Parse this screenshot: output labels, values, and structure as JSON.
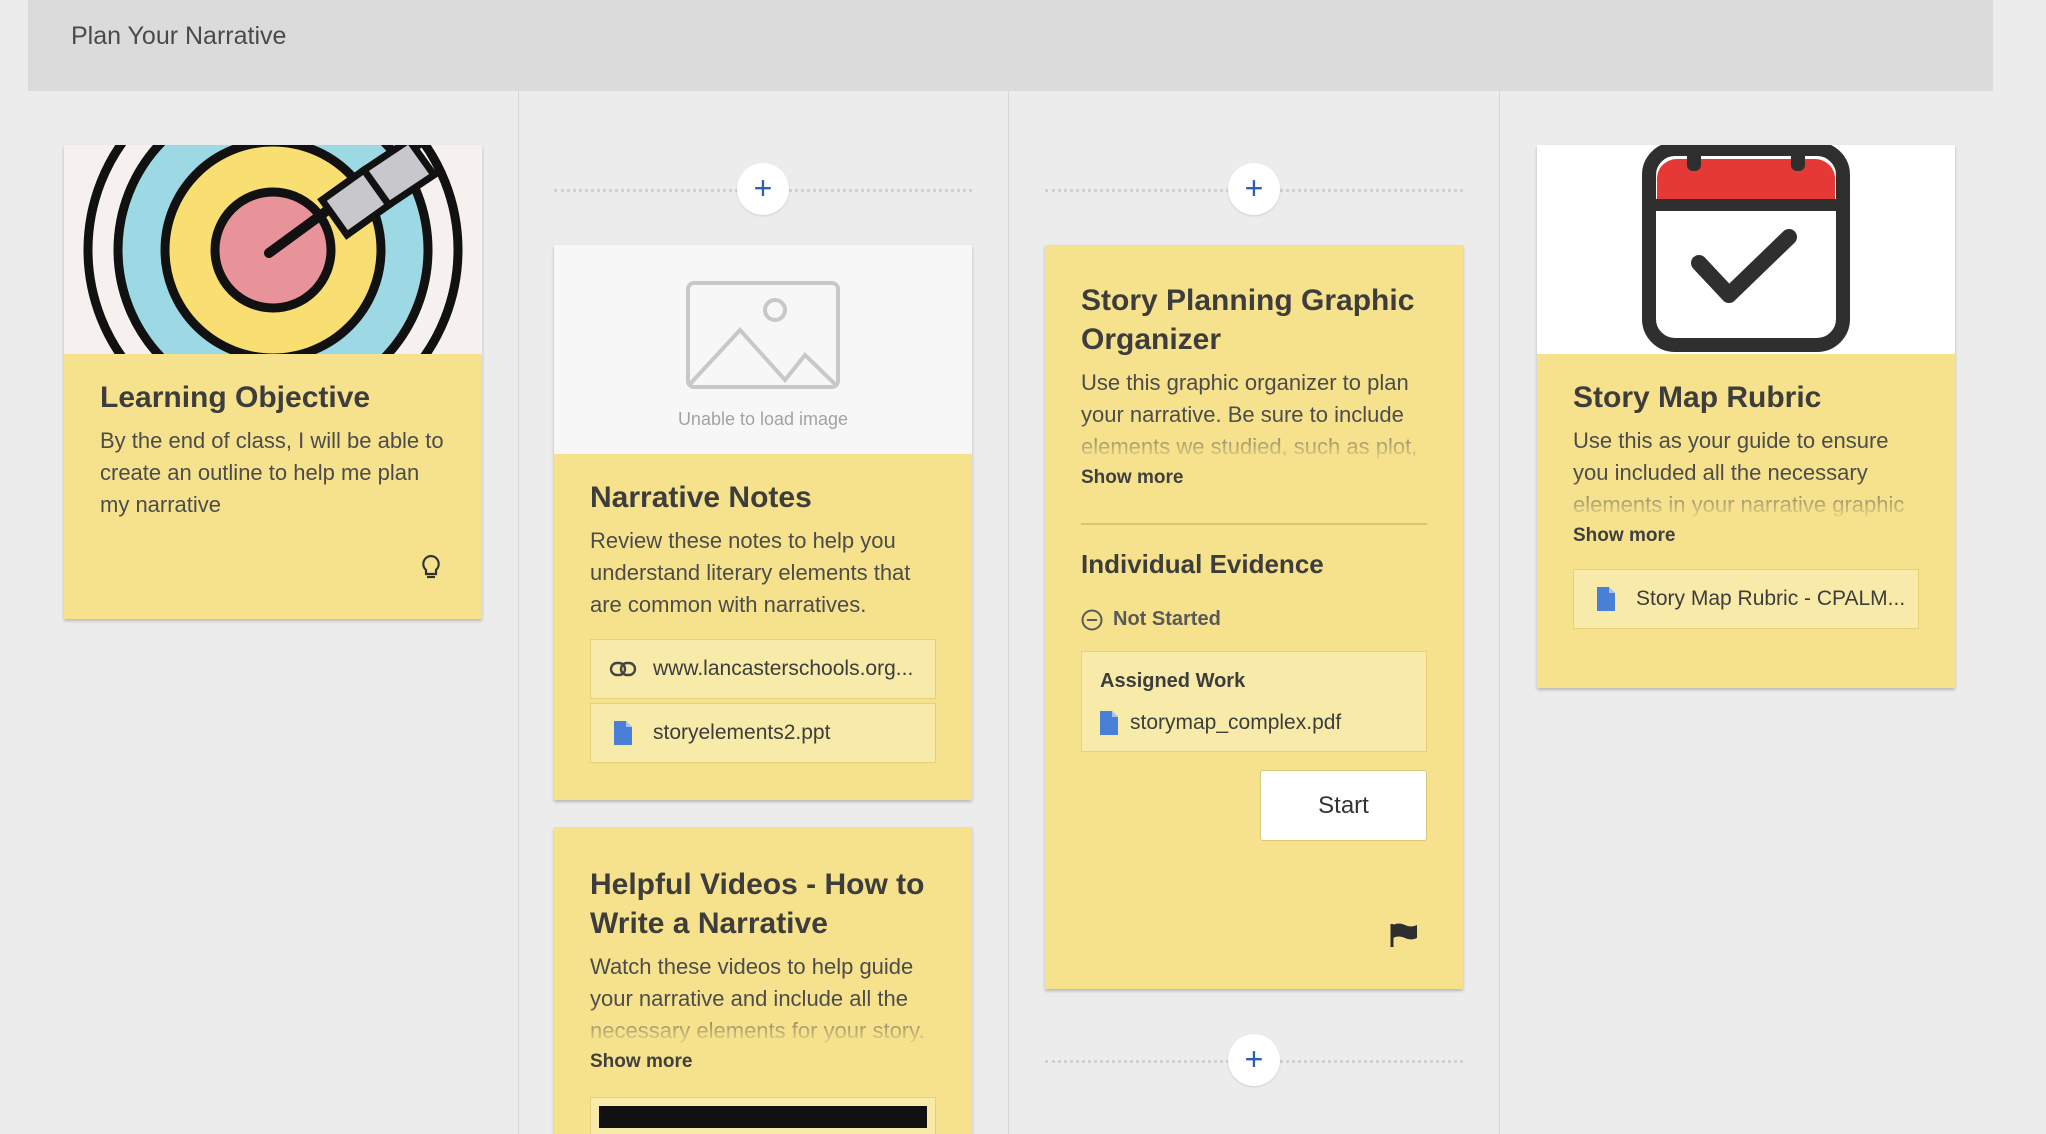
{
  "header": {
    "title": "Plan Your Narrative"
  },
  "cards": {
    "learning_objective": {
      "title": "Learning Objective",
      "description": "By the end of class, I will be able to create an outline to help me plan my narrative",
      "footer_icon": "lightbulb-icon"
    },
    "narrative_notes": {
      "image_error": "Unable to load image",
      "title": "Narrative Notes",
      "description": "Review these notes to help you understand literary elements that are common with narratives.",
      "attachments": [
        {
          "icon": "link-icon",
          "label": "www.lancasterschools.org..."
        },
        {
          "icon": "file-icon",
          "label": "storyelements2.ppt"
        }
      ]
    },
    "helpful_videos": {
      "title": "Helpful Videos - How to Write a Narrative",
      "description": "Watch these videos to help guide your narrative and include all the necessary elements for your story.",
      "show_more": "Show more"
    },
    "story_planning": {
      "title": "Story Planning Graphic Organizer",
      "description": "Use this graphic organizer to plan your narrative. Be sure to include elements we studied, such as plot, characters, dialogue, setting, etc.",
      "show_more": "Show more",
      "section_title": "Individual Evidence",
      "status": "Not Started",
      "assigned_label": "Assigned Work",
      "assigned_file": "storymap_complex.pdf",
      "start_label": "Start",
      "footer_icon": "flag-icon"
    },
    "story_map_rubric": {
      "title": "Story Map Rubric",
      "description": "Use this as your guide to ensure you included all the necessary elements in your narrative graphic organizer.",
      "show_more": "Show more",
      "attachment": "Story Map Rubric - CPALM..."
    }
  },
  "add_buttons": {
    "symbol": "+"
  },
  "colors": {
    "card": "#f6e28c",
    "accent": "#2d5fb0",
    "calendar_red": "#e53935",
    "header": "#dbdbdb"
  }
}
